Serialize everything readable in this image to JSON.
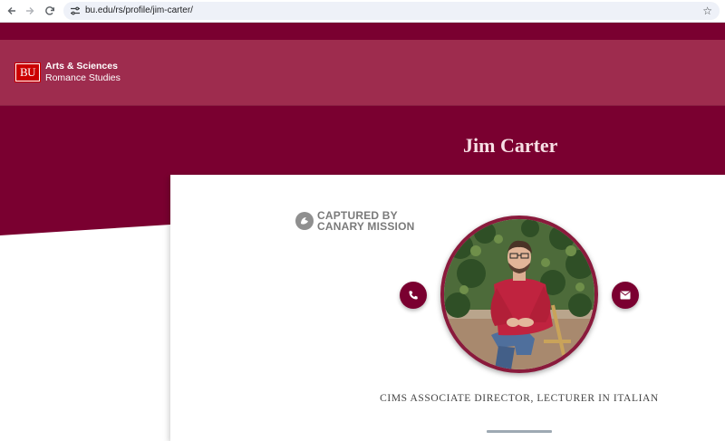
{
  "browser": {
    "url": "bu.edu/rs/profile/jim-carter/"
  },
  "header": {
    "logo_text": "BU",
    "dept_title": "Arts & Sciences",
    "dept_subtitle": "Romance Studies"
  },
  "profile": {
    "name": "Jim Carter",
    "job_title": "CIMS ASSOCIATE DIRECTOR, LECTURER IN ITALIAN"
  },
  "badge": {
    "line1": "CAPTURED BY",
    "line2": "CANARY MISSION"
  },
  "icons": {
    "back": "arrow-left-icon",
    "forward": "arrow-right-icon",
    "reload": "reload-icon",
    "site_info": "tune-icon",
    "bookmark": "star-icon",
    "canary": "bird-icon",
    "phone": "phone-icon",
    "email": "envelope-icon"
  },
  "colors": {
    "brand_maroon": "#7a0030",
    "header_rose": "#9e2c4e",
    "bu_red": "#cc0000",
    "name_pink": "#f7dfe5"
  }
}
